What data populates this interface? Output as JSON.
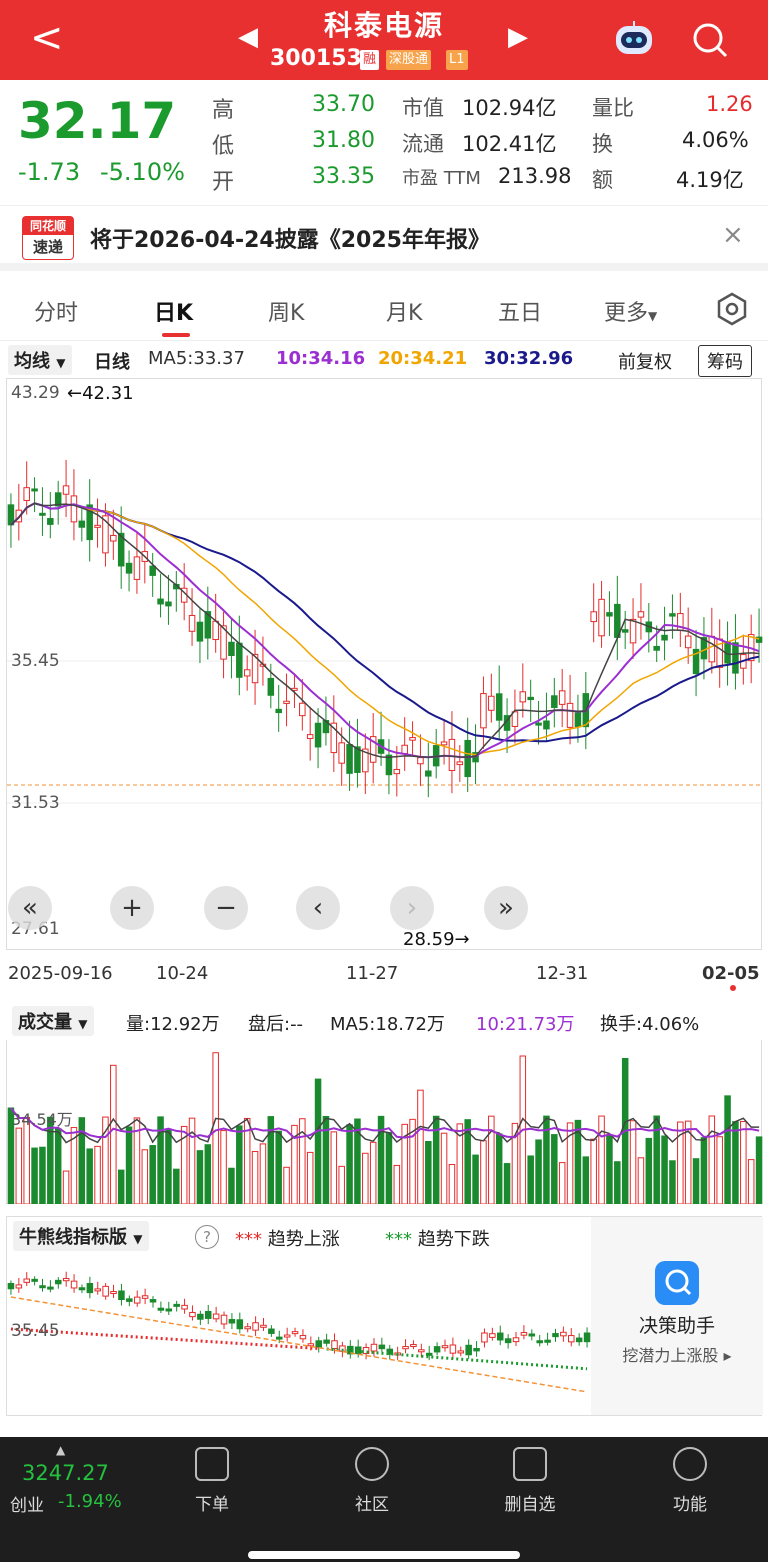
{
  "header": {
    "back": "<",
    "title": "科泰电源",
    "code": "300153",
    "tags": [
      "融",
      "深股通",
      "L1"
    ],
    "prev_arrow": "◀",
    "next_arrow": "▶"
  },
  "quote": {
    "price": "32.17",
    "change": "-1.73",
    "change_pct": "-5.10%",
    "high_label": "高",
    "high": "33.70",
    "low_label": "低",
    "low": "31.80",
    "open_label": "开",
    "open": "33.35",
    "mcap_label": "市值",
    "mcap": "102.94亿",
    "float_label": "流通",
    "float": "102.41亿",
    "pe_label": "市盈 TTM",
    "pe": "213.98",
    "vol_ratio_label": "量比",
    "vol_ratio": "1.26",
    "turnover_label": "换",
    "turnover": "4.06%",
    "amount_label": "额",
    "amount": "4.19亿"
  },
  "notice": {
    "logo_top": "同花顺",
    "logo_bottom": "速递",
    "text": "将于2026-04-24披露《2025年年报》",
    "close": "×"
  },
  "tabs": [
    "分时",
    "日K",
    "周K",
    "月K",
    "五日",
    "更多"
  ],
  "ma_row": {
    "selector": "均线",
    "period": "日线",
    "ma5": "MA5:33.37",
    "ma10": "10:34.16",
    "ma20": "20:34.21",
    "ma30": "30:32.96",
    "adjust": "前复权",
    "chips": "筹码"
  },
  "chart": {
    "y_top": "43.29",
    "y_mid": "35.45",
    "y_low": "31.53",
    "y_bottom": "27.61",
    "max_label": "←42.31",
    "min_label": "28.59→",
    "colors": {
      "up": "#e52b2b",
      "down": "#1b8a2e",
      "ma5": "#444444",
      "ma10": "#9b2fd1",
      "ma20": "#f0a500",
      "ma30": "#1a1a8c"
    }
  },
  "dates": [
    "2025-09-16",
    "10-24",
    "11-27",
    "12-31",
    "02-05"
  ],
  "volume_row": {
    "selector": "成交量",
    "vol": "量:12.92万",
    "after": "盘后:--",
    "ma5": "MA5:18.72万",
    "ma10": "10:21.73万",
    "turnover": "换手:4.06%"
  },
  "volume_axis": "34.54万",
  "bull": {
    "selector": "牛熊线指标版",
    "help": "?",
    "up": "趋势上涨",
    "down": "趋势下跌",
    "y_label": "35.45",
    "assistant_title": "决策助手",
    "assistant_sub": "挖潜力上涨股"
  },
  "bottom": {
    "index_value": "3247.27",
    "index_name": "创业",
    "index_change": "-1.94%",
    "nav": [
      "下单",
      "社区",
      "删自选",
      "功能"
    ]
  }
}
